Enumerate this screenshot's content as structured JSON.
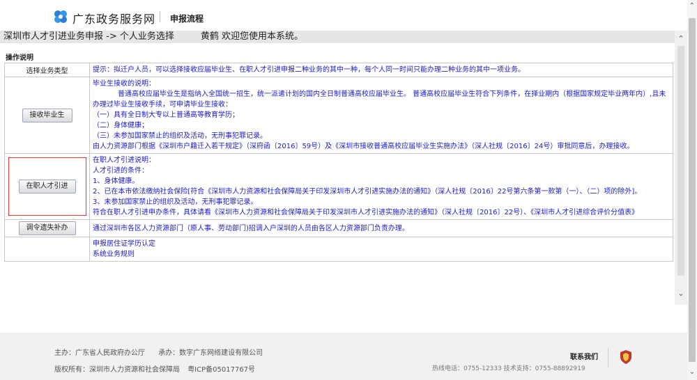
{
  "header": {
    "site_name": "广东政务服务网",
    "section": "申报流程"
  },
  "breadcrumb": {
    "path": "深圳市人才引进业务申报 -> 个人业务选择",
    "greeting": "黄鹤 欢迎您使用本系统。"
  },
  "ops": {
    "title": "操作说明",
    "rows": [
      {
        "left": "选择业务类型",
        "lines": [
          "提示：拟迁户人员，可以选择接收应届毕业生、在职人才引进申报二种业务的其中一种，每个人同一时间只能办理二种业务的其中一项业务。"
        ]
      },
      {
        "button": "接收毕业生",
        "lines": [
          "毕业生接收的说明：",
          "普通高校应届毕业生是指纳入全国统一招生，统一派遣计划的国内全日制普通高校应届毕业生。 普通高校应届毕业生符合下列条件，在择业期内（根据国家规定毕业两年内）,且未办理过毕业生接收手续，可申请毕业生接收：",
          "（一）具有全日制大专以上普通高等教育学历；",
          "（二）身体健康；",
          "（三）未参加国家禁止的组织及活动，无刑事犯罪记录。",
          "由人力资源部门根据《深圳市户籍迁入若干规定》（深府函〔2016〕59号）及《深圳市接收普通高校应届毕业生实施办法》（深人社规〔2016〕24号）审批同意后，办理接收。"
        ]
      },
      {
        "button": "在职人才引进",
        "lines": [
          "在职人才引进说明：",
          "人才引进的条件：",
          "1、身体健康。",
          "2、已在本市依法缴纳社会保险[符合《深圳市人力资源和社会保障局关于印发深圳市人才引进实施办法的通知》（深人社规〔2016〕22号第六条第一款第（一）、（二）项的除外]。",
          "3、未参加国家禁止的组织及活动，无刑事犯罪记录。",
          "符合在职人才引进申办条件，具体请看《深圳市人力资源和社会保障局关于印发深圳市人才引进实施办法的通知》（深人社规〔2016〕22号）、《深圳市人才引进综合评价分值表》"
        ]
      },
      {
        "button": "调令遗失补办",
        "lines": [
          "通过深圳市各区人力资源部门（原人事、劳动部门)招调入户深圳的人员由各区人力资源部门负责办理。"
        ]
      },
      {
        "left": "",
        "lines": [
          "申报居住证学历认定",
          "系统业务规则"
        ]
      }
    ]
  },
  "footer": {
    "sponsor": "主办：广东省人民政府办公厅",
    "undertaker": "承办：数字广东网络建设有限公司",
    "copyright": "版权所有：深圳市人力资源和社会保障局",
    "icp": "粤ICP备05017767号",
    "contact_title": "联系我们",
    "hotline": "热线电话：0755-12333 技术支持：0755-88892919"
  },
  "colors": {
    "link_blue": "#1a1acc",
    "highlight_red": "#ee3333",
    "logo_blue": "#2a7fd4",
    "badge_red": "#c0392b"
  }
}
